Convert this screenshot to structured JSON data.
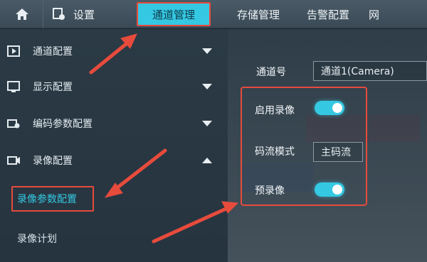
{
  "header": {
    "settings_label": "设置",
    "tabs": [
      {
        "label": "通道管理",
        "active": true
      },
      {
        "label": "存储管理"
      },
      {
        "label": "告警配置"
      },
      {
        "label": "网"
      }
    ]
  },
  "sidebar": {
    "items": [
      {
        "label": "通道配置",
        "expanded": false
      },
      {
        "label": "显示配置",
        "expanded": false
      },
      {
        "label": "编码参数配置",
        "expanded": false
      },
      {
        "label": "录像配置",
        "expanded": true
      }
    ],
    "subitems": [
      {
        "label": "录像参数配置",
        "active": true
      },
      {
        "label": "录像计划"
      }
    ]
  },
  "form": {
    "channel_label": "通道号",
    "channel_value": "通道1(Camera)",
    "enable_record_label": "启用录像",
    "enable_record_on": true,
    "stream_mode_label": "码流模式",
    "stream_mode_value": "主码流",
    "prerecord_label": "预录像",
    "prerecord_on": true
  },
  "colors": {
    "accent": "#35c8e2",
    "annotation": "#e74b3c"
  }
}
